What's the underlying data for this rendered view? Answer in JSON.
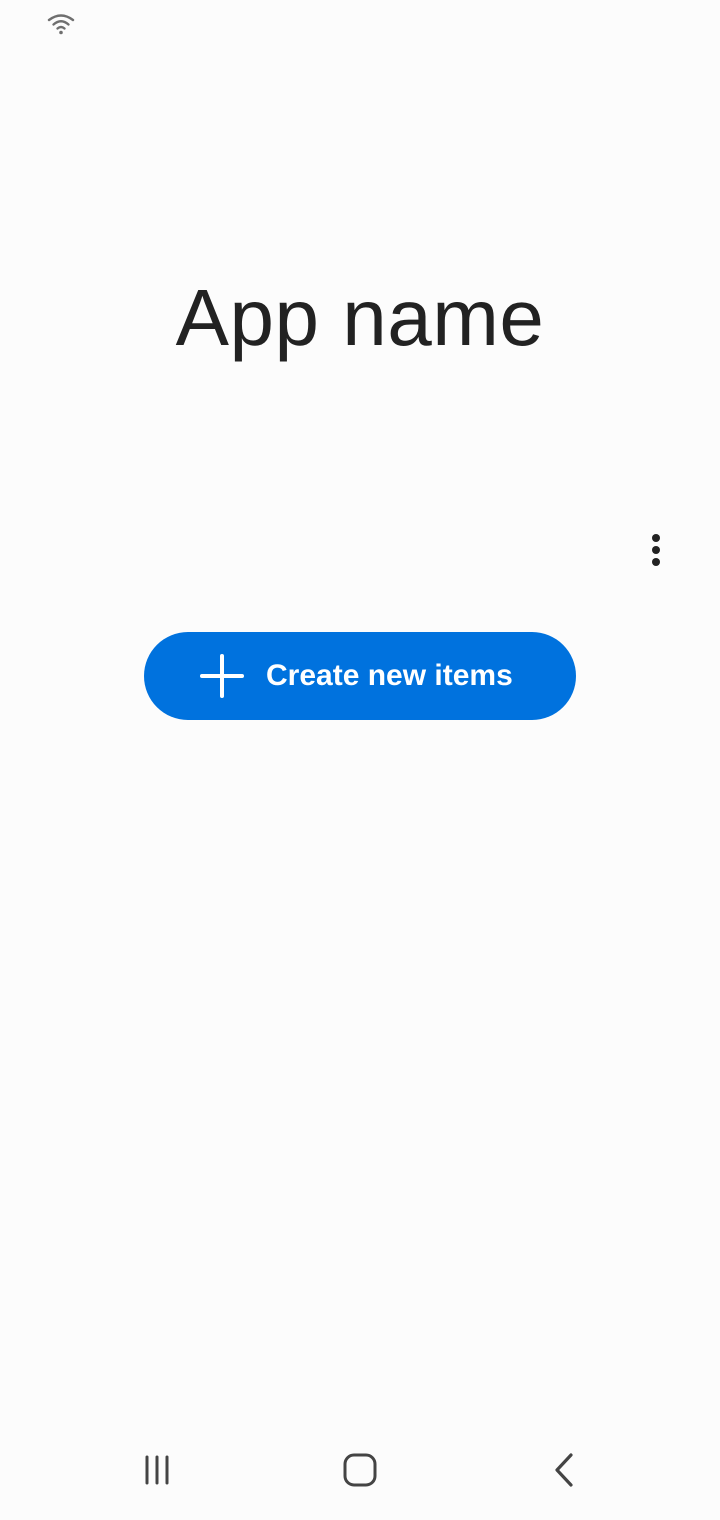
{
  "status_bar": {
    "wifi_icon": "wifi-icon"
  },
  "app": {
    "title": "App name"
  },
  "menu": {
    "more_icon": "more-vert-icon"
  },
  "primary_action": {
    "label": "Create new items",
    "icon": "plus-icon",
    "color": "#0072de"
  },
  "navigation_bar": {
    "recents_icon": "recents-icon",
    "home_icon": "home-icon",
    "back_icon": "back-icon"
  }
}
